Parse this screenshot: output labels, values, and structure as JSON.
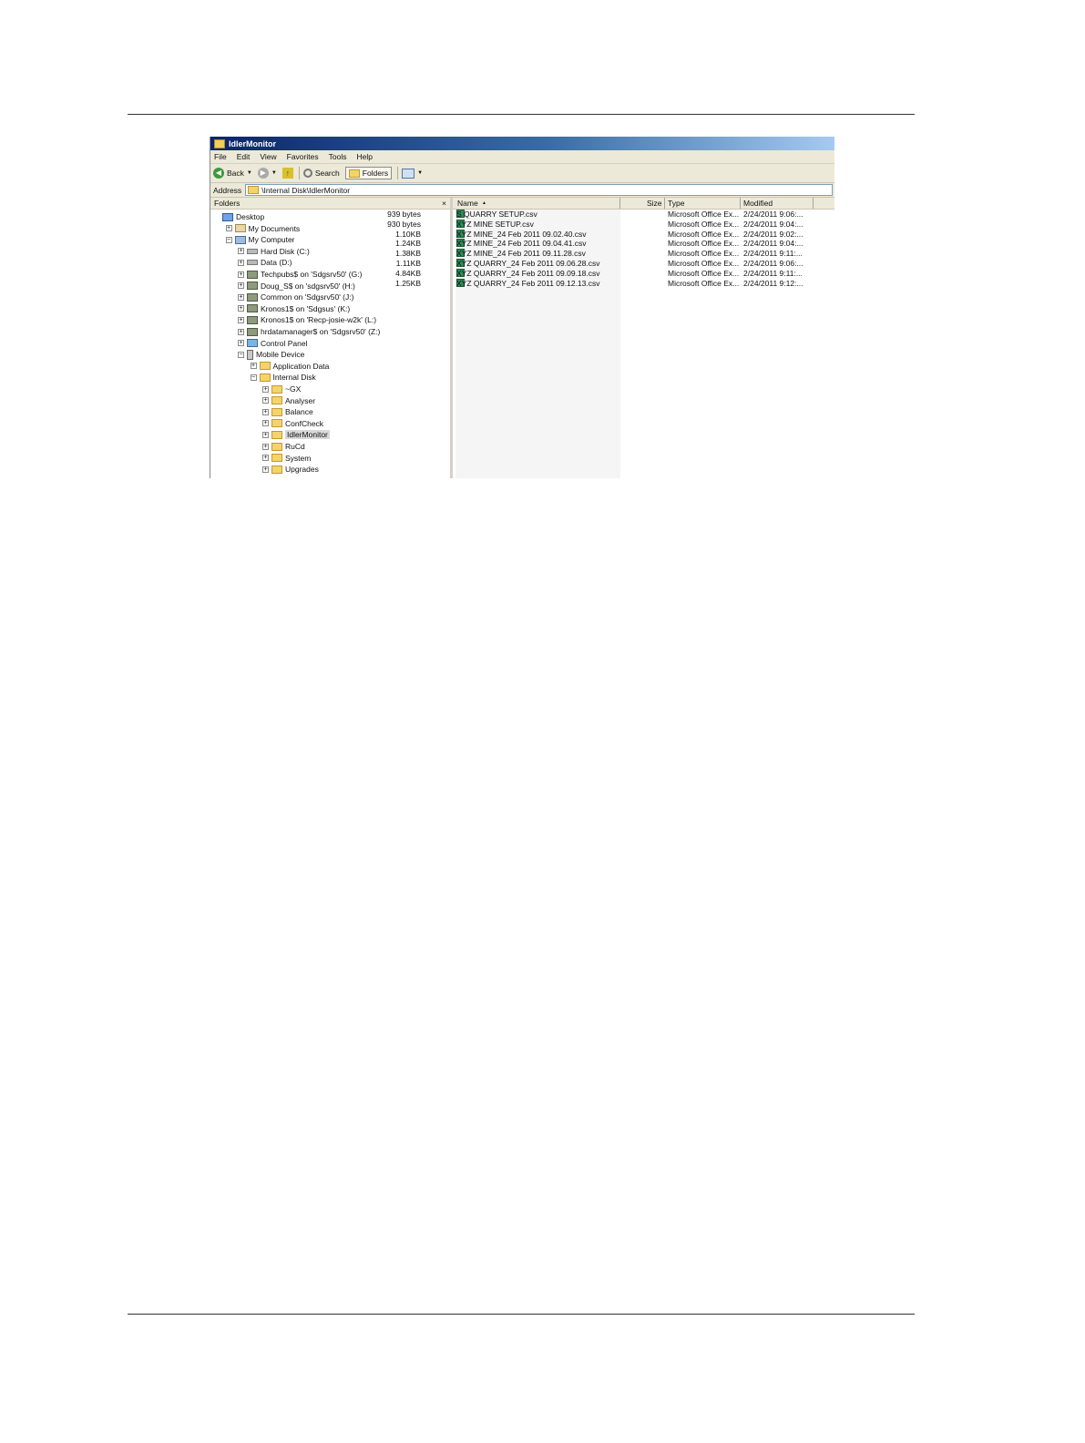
{
  "window": {
    "title": "IdlerMonitor",
    "menu": [
      "File",
      "Edit",
      "View",
      "Favorites",
      "Tools",
      "Help"
    ],
    "toolbar": {
      "back": "Back",
      "search": "Search",
      "folders": "Folders"
    },
    "address": {
      "label": "Address",
      "value": "\\Internal Disk\\IdlerMonitor"
    }
  },
  "folders_pane": {
    "title": "Folders",
    "close": "×",
    "tree": [
      {
        "label": "Desktop",
        "level": 0,
        "icon": "desktop-icon",
        "expander": ""
      },
      {
        "label": "My Documents",
        "level": 1,
        "icon": "documents-icon",
        "expander": "+"
      },
      {
        "label": "My Computer",
        "level": 1,
        "icon": "computer-icon",
        "expander": "−"
      },
      {
        "label": "Hard Disk (C:)",
        "level": 2,
        "icon": "drive-icon",
        "expander": "+"
      },
      {
        "label": "Data (D:)",
        "level": 2,
        "icon": "drive-icon",
        "expander": "+"
      },
      {
        "label": "Techpubs$ on 'Sdgsrv50' (G:)",
        "level": 2,
        "icon": "network-drive-icon",
        "expander": "+"
      },
      {
        "label": "Doug_S$ on 'sdgsrv50' (H:)",
        "level": 2,
        "icon": "network-drive-icon",
        "expander": "+"
      },
      {
        "label": "Common on 'Sdgsrv50' (J:)",
        "level": 2,
        "icon": "network-drive-icon",
        "expander": "+"
      },
      {
        "label": "Kronos1$ on 'Sdgsus' (K:)",
        "level": 2,
        "icon": "network-drive-icon",
        "expander": "+"
      },
      {
        "label": "Kronos1$ on 'Recp-josie-w2k' (L:)",
        "level": 2,
        "icon": "network-drive-icon",
        "expander": "+"
      },
      {
        "label": "hrdatamanager$ on 'Sdgsrv50' (Z:)",
        "level": 2,
        "icon": "network-drive-icon",
        "expander": "+"
      },
      {
        "label": "Control Panel",
        "level": 2,
        "icon": "control-panel-icon",
        "expander": "+"
      },
      {
        "label": "Mobile Device",
        "level": 2,
        "icon": "mobile-device-icon",
        "expander": "−"
      },
      {
        "label": "Application Data",
        "level": 3,
        "icon": "folder-icon",
        "expander": "+"
      },
      {
        "label": "Internal Disk",
        "level": 3,
        "icon": "folder-icon",
        "expander": "−"
      },
      {
        "label": "~GX",
        "level": 4,
        "icon": "folder-icon",
        "expander": "+"
      },
      {
        "label": "Analyser",
        "level": 4,
        "icon": "folder-icon",
        "expander": "+"
      },
      {
        "label": "Balance",
        "level": 4,
        "icon": "folder-icon",
        "expander": "+"
      },
      {
        "label": "ConfCheck",
        "level": 4,
        "icon": "folder-icon",
        "expander": "+"
      },
      {
        "label": "IdlerMonitor",
        "level": 4,
        "icon": "folder-icon",
        "expander": "+",
        "selected": true
      },
      {
        "label": "RuCd",
        "level": 4,
        "icon": "folder-icon",
        "expander": "+"
      },
      {
        "label": "System",
        "level": 4,
        "icon": "folder-icon",
        "expander": "+"
      },
      {
        "label": "Upgrades",
        "level": 4,
        "icon": "folder-icon",
        "expander": "+"
      }
    ]
  },
  "files_pane": {
    "columns": {
      "name": "Name",
      "sort": "▲",
      "size": "Size",
      "type": "Type",
      "modified": "Modified"
    },
    "rows": [
      {
        "name": "S QUARRY SETUP.csv",
        "size": "939 bytes",
        "type": "Microsoft Office Ex...",
        "modified": "2/24/2011  9:06:..."
      },
      {
        "name": "XYZ MINE SETUP.csv",
        "size": "930 bytes",
        "type": "Microsoft Office Ex...",
        "modified": "2/24/2011  9:04:..."
      },
      {
        "name": "XYZ MINE_24 Feb 2011 09.02.40.csv",
        "size": "1.10KB",
        "type": "Microsoft Office Ex...",
        "modified": "2/24/2011  9:02:..."
      },
      {
        "name": "XYZ MINE_24 Feb 2011 09.04.41.csv",
        "size": "1.24KB",
        "type": "Microsoft Office Ex...",
        "modified": "2/24/2011  9:04:..."
      },
      {
        "name": "XYZ MINE_24 Feb 2011 09.11.28.csv",
        "size": "1.38KB",
        "type": "Microsoft Office Ex...",
        "modified": "2/24/2011  9:11:..."
      },
      {
        "name": "XYZ QUARRY_24 Feb 2011 09.06.28.csv",
        "size": "1.11KB",
        "type": "Microsoft Office Ex...",
        "modified": "2/24/2011  9:06:..."
      },
      {
        "name": "XYZ QUARRY_24 Feb 2011 09.09.18.csv",
        "size": "4.84KB",
        "type": "Microsoft Office Ex...",
        "modified": "2/24/2011  9:11:..."
      },
      {
        "name": "XYZ QUARRY_24 Feb 2011 09.12.13.csv",
        "size": "1.25KB",
        "type": "Microsoft Office Ex...",
        "modified": "2/24/2011  9:12:..."
      }
    ]
  }
}
